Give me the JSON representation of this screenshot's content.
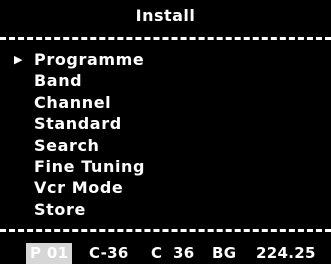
{
  "title": "Install",
  "cursor_glyph": "▶",
  "menu": {
    "selected_index": 0,
    "items": [
      {
        "label": "Programme"
      },
      {
        "label": "Band"
      },
      {
        "label": "Channel"
      },
      {
        "label": "Standard"
      },
      {
        "label": "Search"
      },
      {
        "label": "Fine Tuning"
      },
      {
        "label": "Vcr Mode"
      },
      {
        "label": "Store"
      }
    ]
  },
  "status": {
    "programme_prefix": "P",
    "programme_number": "01",
    "channel_code": "C-36",
    "channel_type": "C",
    "channel_number": "36",
    "standard": "BG",
    "frequency": "224.25"
  },
  "colors": {
    "background": "#000000",
    "text": "#ffffff",
    "highlight": "#d6d6d6"
  }
}
